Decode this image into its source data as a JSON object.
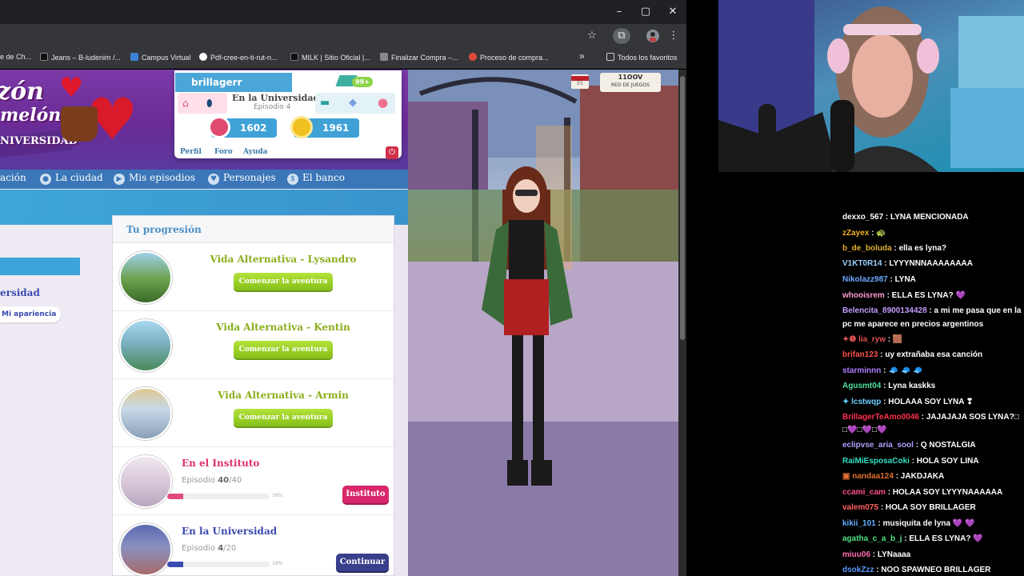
{
  "browser": {
    "window_controls": [
      "–",
      "▢",
      "✕"
    ],
    "bookmarks": [
      {
        "label": "e de Ch...",
        "color": "#ffffff"
      },
      {
        "label": "Jeans – B-ludenim /...",
        "color": "#111111"
      },
      {
        "label": "Campus Virtual",
        "color": "#3b82d6"
      },
      {
        "label": "Pdf-cree-en-ti-rut-n...",
        "color": "#ffffff"
      },
      {
        "label": "MILK | Sitio Oficial |...",
        "color": "#111111"
      },
      {
        "label": "Finalizar Compra –...",
        "color": "#888888"
      },
      {
        "label": "Proceso de compra...",
        "color": "#e04a3a"
      }
    ],
    "overflow_label": "»",
    "all_bookmarks_label": "Todos los favoritos"
  },
  "game": {
    "logo": {
      "line1": "zón",
      "line2": "melón",
      "line3": "NIVERSIDAD"
    },
    "user": {
      "username": "brillagerr",
      "badge": "99+",
      "episode_title": "En la Universidad",
      "episode_sub": "Episodio 4",
      "pa": "1602",
      "dollars": "1961",
      "links": [
        "Perfil",
        "Foro",
        "Ayuda"
      ]
    },
    "lang": "ES",
    "network": "RED DE JUEGOS",
    "network_brand": "11OOV",
    "nav": [
      {
        "icon": "home-icon",
        "label": "ación"
      },
      {
        "icon": "city-icon",
        "label": "La ciudad"
      },
      {
        "icon": "play-icon",
        "label": "Mis episodios"
      },
      {
        "icon": "heart-icon",
        "label": "Personajes"
      },
      {
        "icon": "bank-icon",
        "label": "El banco"
      }
    ],
    "left": {
      "uni_label": "ersidad",
      "appearance_button": "Mi apariencia"
    },
    "progress": {
      "title": "Tu progresión",
      "alternatives": [
        {
          "title": "Vida Alternativa - Lysandro",
          "button": "Comenzar la aventura"
        },
        {
          "title": "Vida Alternativa - Kentin",
          "button": "Comenzar la aventura"
        },
        {
          "title": "Vida Alternativa - Armin",
          "button": "Comenzar la aventura"
        }
      ],
      "episodes": [
        {
          "title": "En el Instituto",
          "prefix": "Episodio ",
          "current": "40",
          "total": "/40",
          "percent_label": "16%",
          "fill": 0.16,
          "button": "Instituto",
          "color": "#e03070",
          "button_color": "#d8276a"
        },
        {
          "title": "En la Universidad",
          "prefix": "Episodio ",
          "current": "4",
          "total": "/20",
          "percent_label": "16%",
          "fill": 0.16,
          "button": "Continuar",
          "color": "#3a4ab0",
          "button_color": "#3a3f8c"
        }
      ]
    }
  },
  "chat": [
    {
      "user": "dexxo_567",
      "color": "#ffffff",
      "text": " : LYNA MENCIONADA"
    },
    {
      "user": "zZayex",
      "color": "#f0b020",
      "text": " : 🐢"
    },
    {
      "user": "b_de_boluda",
      "color": "#e0b030",
      "text": " : ella es lyna?"
    },
    {
      "user": "V1KT0R14",
      "color": "#9fd0ff",
      "text": " : LYYYNNNAAAAAAAA"
    },
    {
      "user": "Nikolazz987",
      "color": "#6ea8ff",
      "text": " : LYNA"
    },
    {
      "user": "whooisrem",
      "color": "#ff9ad0",
      "text": " : ELLA ES LYNA? 💜"
    },
    {
      "user": "Belencita_8900134428",
      "color": "#c59bff",
      "text": " : a mi me pasa que en la"
    },
    {
      "user": "",
      "color": "#ffffff",
      "text": "pc me aparece en precios argentinos"
    },
    {
      "user": "✦❶ lia_ryw",
      "color": "#e05050",
      "text": " : 🟫"
    },
    {
      "user": "brifan123",
      "color": "#ff5050",
      "text": " : uy extrañaba esa canción"
    },
    {
      "user": "starminnn",
      "color": "#b07cff",
      "text": " : 🧢 🧢 🧢"
    },
    {
      "user": "Agusmt04",
      "color": "#50e0a0",
      "text": " : Lyna kaskks"
    },
    {
      "user": "✦ lcstwqp",
      "color": "#6ad0ff",
      "text": " : HOLAAA SOY LYNA ❣"
    },
    {
      "user": "BrillagerTeAmo0046",
      "color": "#ff3050",
      "text": " : JAJAJAJA SOS LYNA?□"
    },
    {
      "user": "",
      "color": "#ffffff",
      "text": "□💜□💜□💜"
    },
    {
      "user": "eclipvse_aria_sool",
      "color": "#b0a0ff",
      "text": " : Q NOSTALGIA"
    },
    {
      "user": "RaiMiEsposaCoki",
      "color": "#30e0c0",
      "text": " : HOLA SOY LINA"
    },
    {
      "user": "▣ nandaa124",
      "color": "#e07030",
      "text": " : JAKDJAKA"
    },
    {
      "user": "ccami_cam",
      "color": "#ff5090",
      "text": " : HOLAA SOY LYYYNAAAAAA"
    },
    {
      "user": "valem075",
      "color": "#ff6060",
      "text": " : HOLA SOY BRILLAGER"
    },
    {
      "user": "kikii_101",
      "color": "#60b0ff",
      "text": " : musiquita de lyna 💜 💜"
    },
    {
      "user": "agatha_c_a_b_j",
      "color": "#50e080",
      "text": " : ELLA ES LYNA? 💜"
    },
    {
      "user": "miuu06",
      "color": "#ff70b0",
      "text": " : LYNaaaa"
    },
    {
      "user": "dsokZzz",
      "color": "#5a9aff",
      "text": " : NOO SPAWNEO BRILLAGER"
    }
  ]
}
